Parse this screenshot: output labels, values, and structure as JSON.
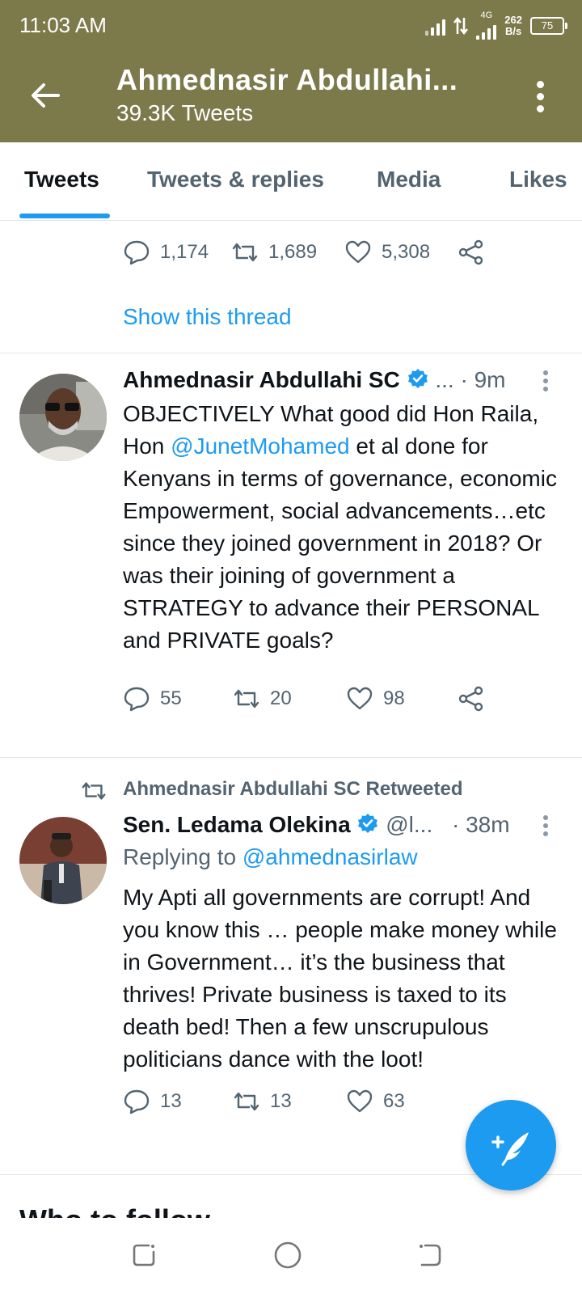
{
  "status_bar": {
    "time": "11:03 AM",
    "network": "4G",
    "speed_value": "262",
    "speed_unit": "B/s",
    "battery": "75"
  },
  "header": {
    "title": "Ahmednasir Abdullahi...",
    "subtitle": "39.3K Tweets"
  },
  "tabs": [
    "Tweets",
    "Tweets & replies",
    "Media",
    "Likes"
  ],
  "tweet0": {
    "replies": "1,174",
    "retweets": "1,689",
    "likes": "5,308",
    "thread_link": "Show this thread"
  },
  "tweet1": {
    "author": "Ahmednasir Abdullahi SC",
    "handle": "...",
    "time": "· 9m",
    "text_a": "OBJECTIVELY What good did Hon Raila, Hon ",
    "mention": "@JunetMohamed",
    "text_b": " et al done for Kenyans in terms of governance, economic Empowerment, social advancements…etc since they joined government in 2018? Or was their joining of government a STRATEGY to advance their PERSONAL and PRIVATE goals?",
    "replies": "55",
    "retweets": "20",
    "likes": "98"
  },
  "tweet2": {
    "retweeted_by": "Ahmednasir Abdullahi SC Retweeted",
    "author": "Sen. Ledama Olekina",
    "handle": "@l...",
    "time": "· 38m",
    "replying_label": "Replying to ",
    "replying_to": "@ahmednasirlaw",
    "text": "My Apti all governments are corrupt! And you know this … people make money while in Government… it’s the business that thrives! Private business is taxed to its death bed! Then a few unscrupulous politicians dance with the loot!",
    "replies": "13",
    "retweets": "13",
    "likes": "63"
  },
  "who_to_follow": "Who to follow",
  "colors": {
    "header_bg": "#7c7a4a",
    "accent": "#1d9bf0",
    "muted": "#536471"
  }
}
